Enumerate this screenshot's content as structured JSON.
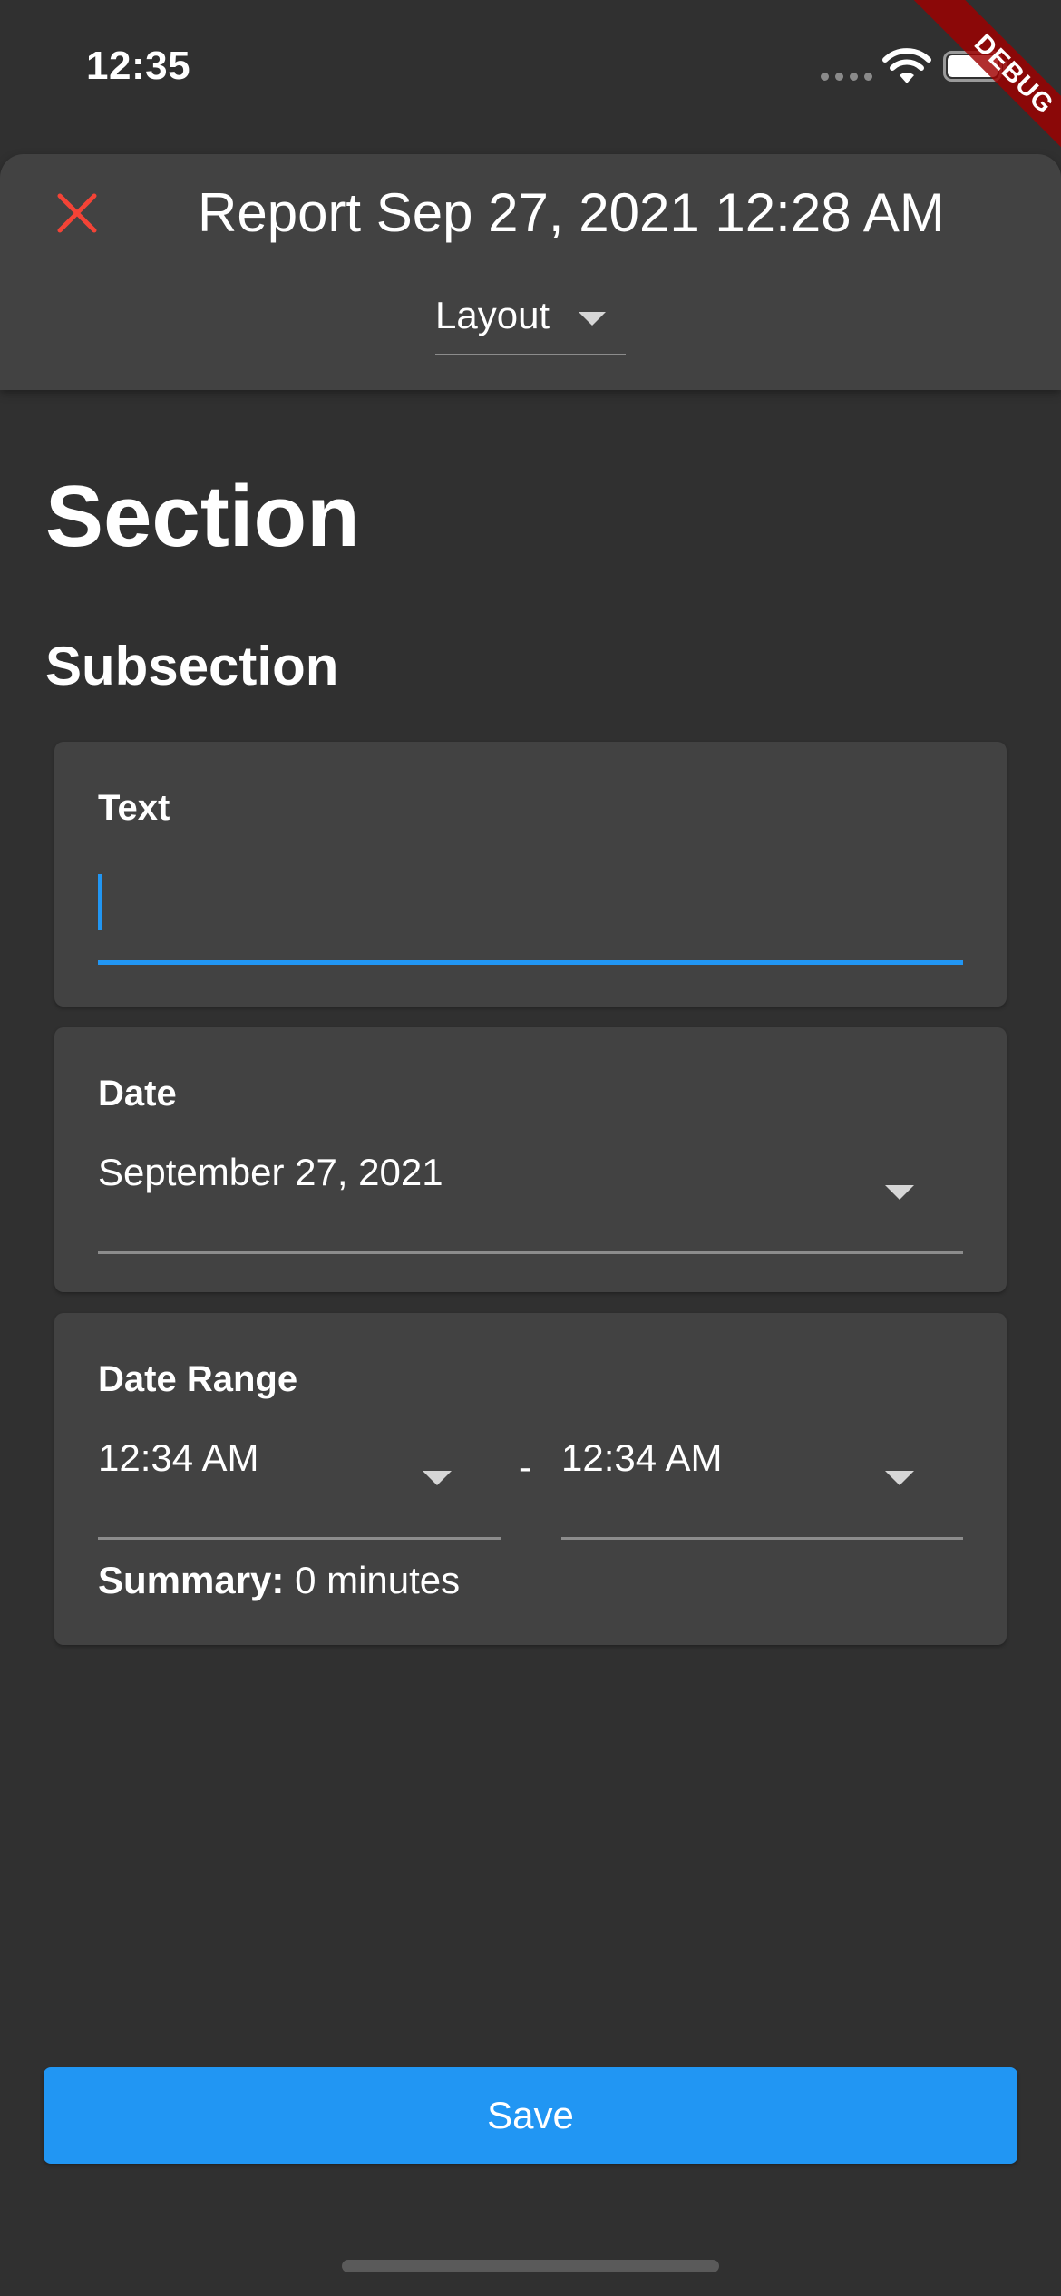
{
  "status_bar": {
    "time": "12:35",
    "icons": [
      "signal-dots-icon",
      "wifi-icon",
      "battery-icon"
    ]
  },
  "debug_banner": "DEBUG",
  "app_bar": {
    "close_icon": "close-icon",
    "title": "Report Sep 27, 2021 12:28 AM",
    "layout_dropdown": {
      "value": "Layout",
      "icon": "caret-down-icon"
    }
  },
  "content": {
    "section_title": "Section",
    "subsection_title": "Subsection",
    "text_field": {
      "label": "Text",
      "value": ""
    },
    "date_field": {
      "label": "Date",
      "value": "September 27, 2021"
    },
    "date_range_field": {
      "label": "Date Range",
      "start": "12:34 AM",
      "separator": "-",
      "end": "12:34 AM",
      "summary_label": "Summary:",
      "summary_value": "0 minutes"
    }
  },
  "save_button": {
    "label": "Save"
  },
  "colors": {
    "background": "#303030",
    "surface": "#424242",
    "accent": "#2196f3",
    "close": "#f44336",
    "debug_banner": "#a00000"
  }
}
